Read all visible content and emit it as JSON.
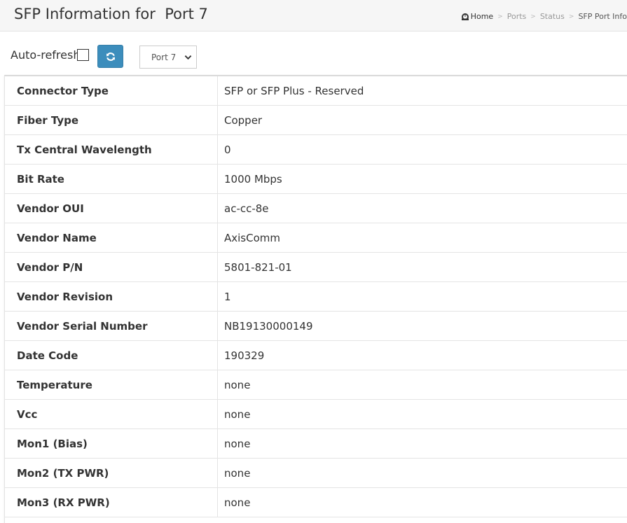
{
  "header": {
    "title": "SFP Information for  Port 7",
    "breadcrumb": [
      "Home",
      "Ports",
      "Status",
      "SFP Port Info"
    ]
  },
  "toolbar": {
    "auto_refresh_label": "Auto-refresh",
    "auto_refresh_checked": false,
    "refresh_icon": "refresh-icon",
    "port_select_value": "Port 7"
  },
  "table": {
    "rows": [
      {
        "key": "Connector Type",
        "value": "SFP or SFP Plus - Reserved"
      },
      {
        "key": "Fiber Type",
        "value": "Copper"
      },
      {
        "key": "Tx Central Wavelength",
        "value": "0"
      },
      {
        "key": "Bit Rate",
        "value": "1000 Mbps"
      },
      {
        "key": "Vendor OUI",
        "value": "ac-cc-8e"
      },
      {
        "key": "Vendor Name",
        "value": "AxisComm"
      },
      {
        "key": "Vendor P/N",
        "value": "5801-821-01"
      },
      {
        "key": "Vendor Revision",
        "value": "1"
      },
      {
        "key": "Vendor Serial Number",
        "value": "NB19130000149"
      },
      {
        "key": "Date Code",
        "value": "190329"
      },
      {
        "key": "Temperature",
        "value": "none"
      },
      {
        "key": "Vcc",
        "value": "none"
      },
      {
        "key": "Mon1 (Bias)",
        "value": "none"
      },
      {
        "key": "Mon2 (TX PWR)",
        "value": "none"
      },
      {
        "key": "Mon3 (RX PWR)",
        "value": "none"
      }
    ]
  },
  "colors": {
    "accent": "#3c8dbc",
    "header_bg": "#f6f6f6",
    "border": "#e4e4e4"
  }
}
